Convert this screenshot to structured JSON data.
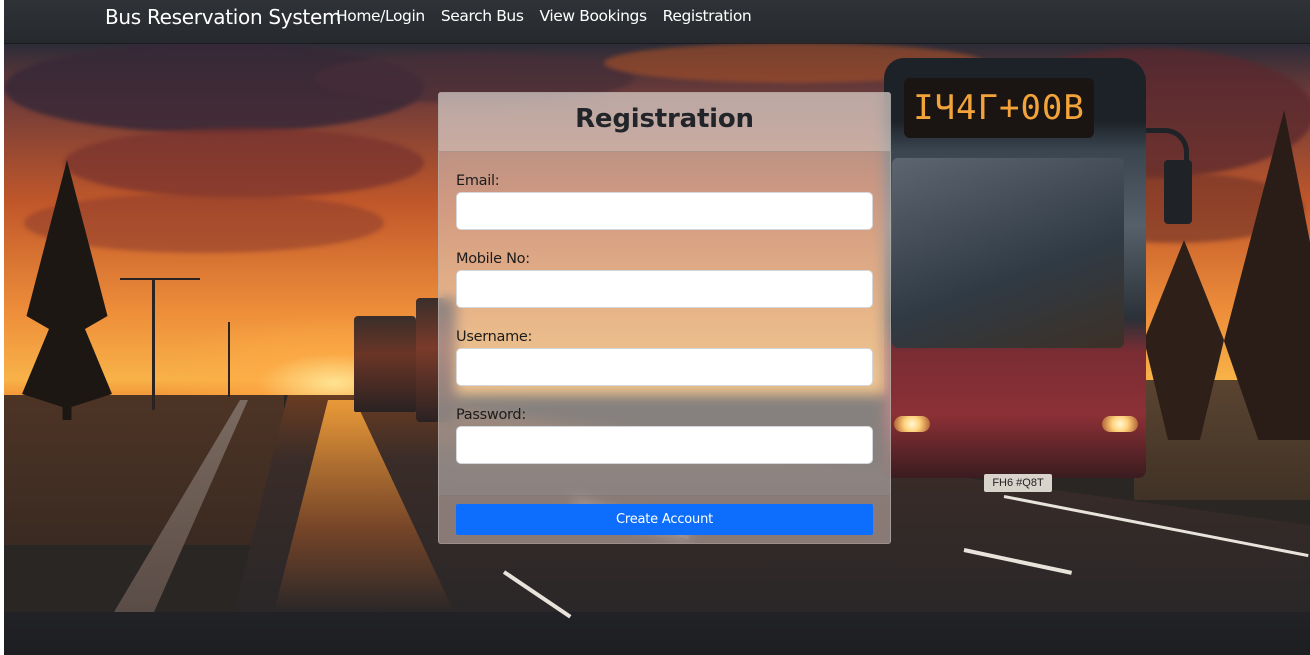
{
  "navbar": {
    "brand": "Bus Reservation System",
    "links": [
      {
        "label": "Home/Login"
      },
      {
        "label": "Search Bus"
      },
      {
        "label": "View Bookings"
      },
      {
        "label": "Registration"
      }
    ]
  },
  "hero": {
    "bus_sign_text": "IЧ4Г+00B",
    "bus_plate_text": "FH6 #Q8T"
  },
  "form": {
    "title": "Registration",
    "fields": [
      {
        "label": "Email:",
        "value": "",
        "placeholder": ""
      },
      {
        "label": "Mobile No:",
        "value": "",
        "placeholder": ""
      },
      {
        "label": "Username:",
        "value": "",
        "placeholder": ""
      },
      {
        "label": "Password:",
        "value": "",
        "placeholder": ""
      }
    ],
    "submit_label": "Create Account"
  },
  "colors": {
    "navbar_bg": "#2b2e32",
    "primary": "#0d6efd",
    "title_text": "#212529"
  }
}
